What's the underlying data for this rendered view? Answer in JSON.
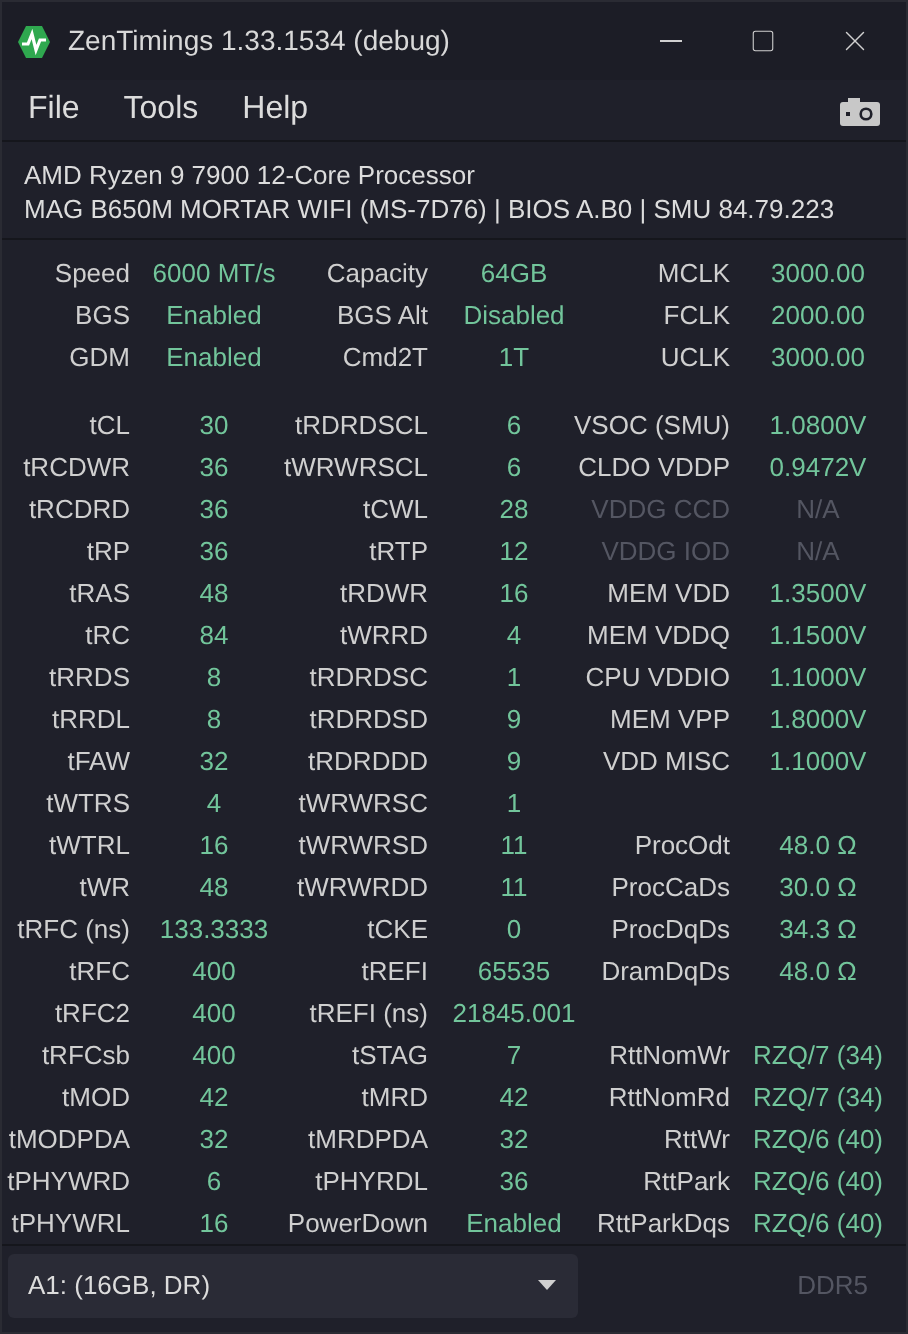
{
  "window": {
    "title": "ZenTimings 1.33.1534 (debug)"
  },
  "menu": [
    "File",
    "Tools",
    "Help"
  ],
  "system_info": {
    "cpu": "AMD Ryzen 9 7900 12-Core Processor",
    "board": "MAG B650M MORTAR WIFI (MS-7D76) | BIOS A.B0 | SMU 84.79.223"
  },
  "summary": [
    {
      "left": {
        "label": "Speed",
        "value": "6000 MT/s",
        "disabled": false
      },
      "middle": {
        "label": "Capacity",
        "value": "64GB",
        "disabled": false
      },
      "right": {
        "label": "MCLK",
        "value": "3000.00",
        "disabled": false
      }
    },
    {
      "left": {
        "label": "BGS",
        "value": "Enabled",
        "disabled": false
      },
      "middle": {
        "label": "BGS Alt",
        "value": "Disabled",
        "disabled": false
      },
      "right": {
        "label": "FCLK",
        "value": "2000.00",
        "disabled": false
      }
    },
    {
      "left": {
        "label": "GDM",
        "value": "Enabled",
        "disabled": false
      },
      "middle": {
        "label": "Cmd2T",
        "value": "1T",
        "disabled": false
      },
      "right": {
        "label": "UCLK",
        "value": "3000.00",
        "disabled": false
      }
    }
  ],
  "timings": [
    {
      "left": {
        "label": "tCL",
        "value": "30",
        "disabled": false
      },
      "middle": {
        "label": "tRDRDSCL",
        "value": "6",
        "disabled": false
      },
      "right": {
        "label": "VSOC (SMU)",
        "value": "1.0800V",
        "disabled": false
      }
    },
    {
      "left": {
        "label": "tRCDWR",
        "value": "36",
        "disabled": false
      },
      "middle": {
        "label": "tWRWRSCL",
        "value": "6",
        "disabled": false
      },
      "right": {
        "label": "CLDO VDDP",
        "value": "0.9472V",
        "disabled": false
      }
    },
    {
      "left": {
        "label": "tRCDRD",
        "value": "36",
        "disabled": false
      },
      "middle": {
        "label": "tCWL",
        "value": "28",
        "disabled": false
      },
      "right": {
        "label": "VDDG CCD",
        "value": "N/A",
        "disabled": true
      }
    },
    {
      "left": {
        "label": "tRP",
        "value": "36",
        "disabled": false
      },
      "middle": {
        "label": "tRTP",
        "value": "12",
        "disabled": false
      },
      "right": {
        "label": "VDDG IOD",
        "value": "N/A",
        "disabled": true
      }
    },
    {
      "left": {
        "label": "tRAS",
        "value": "48",
        "disabled": false
      },
      "middle": {
        "label": "tRDWR",
        "value": "16",
        "disabled": false
      },
      "right": {
        "label": "MEM VDD",
        "value": "1.3500V",
        "disabled": false
      }
    },
    {
      "left": {
        "label": "tRC",
        "value": "84",
        "disabled": false
      },
      "middle": {
        "label": "tWRRD",
        "value": "4",
        "disabled": false
      },
      "right": {
        "label": "MEM VDDQ",
        "value": "1.1500V",
        "disabled": false
      }
    },
    {
      "left": {
        "label": "tRRDS",
        "value": "8",
        "disabled": false
      },
      "middle": {
        "label": "tRDRDSC",
        "value": "1",
        "disabled": false
      },
      "right": {
        "label": "CPU VDDIO",
        "value": "1.1000V",
        "disabled": false
      }
    },
    {
      "left": {
        "label": "tRRDL",
        "value": "8",
        "disabled": false
      },
      "middle": {
        "label": "tRDRDSD",
        "value": "9",
        "disabled": false
      },
      "right": {
        "label": "MEM VPP",
        "value": "1.8000V",
        "disabled": false
      }
    },
    {
      "left": {
        "label": "tFAW",
        "value": "32",
        "disabled": false
      },
      "middle": {
        "label": "tRDRDDD",
        "value": "9",
        "disabled": false
      },
      "right": {
        "label": "VDD MISC",
        "value": "1.1000V",
        "disabled": false
      }
    },
    {
      "left": {
        "label": "tWTRS",
        "value": "4",
        "disabled": false
      },
      "middle": {
        "label": "tWRWRSC",
        "value": "1",
        "disabled": false
      }
    },
    {
      "left": {
        "label": "tWTRL",
        "value": "16",
        "disabled": false
      },
      "middle": {
        "label": "tWRWRSD",
        "value": "11",
        "disabled": false
      },
      "right": {
        "label": "ProcOdt",
        "value": "48.0 Ω",
        "disabled": false
      }
    },
    {
      "left": {
        "label": "tWR",
        "value": "48",
        "disabled": false
      },
      "middle": {
        "label": "tWRWRDD",
        "value": "11",
        "disabled": false
      },
      "right": {
        "label": "ProcCaDs",
        "value": "30.0 Ω",
        "disabled": false
      }
    },
    {
      "left": {
        "label": "tRFC (ns)",
        "value": "133.3333",
        "disabled": false
      },
      "middle": {
        "label": "tCKE",
        "value": "0",
        "disabled": false
      },
      "right": {
        "label": "ProcDqDs",
        "value": "34.3 Ω",
        "disabled": false
      }
    },
    {
      "left": {
        "label": "tRFC",
        "value": "400",
        "disabled": false
      },
      "middle": {
        "label": "tREFI",
        "value": "65535",
        "disabled": false
      },
      "right": {
        "label": "DramDqDs",
        "value": "48.0 Ω",
        "disabled": false
      }
    },
    {
      "left": {
        "label": "tRFC2",
        "value": "400",
        "disabled": false
      },
      "middle": {
        "label": "tREFI (ns)",
        "value": "21845.001",
        "disabled": false
      }
    },
    {
      "left": {
        "label": "tRFCsb",
        "value": "400",
        "disabled": false
      },
      "middle": {
        "label": "tSTAG",
        "value": "7",
        "disabled": false
      },
      "right": {
        "label": "RttNomWr",
        "value": "RZQ/7 (34)",
        "disabled": false
      }
    },
    {
      "left": {
        "label": "tMOD",
        "value": "42",
        "disabled": false
      },
      "middle": {
        "label": "tMRD",
        "value": "42",
        "disabled": false
      },
      "right": {
        "label": "RttNomRd",
        "value": "RZQ/7 (34)",
        "disabled": false
      }
    },
    {
      "left": {
        "label": "tMODPDA",
        "value": "32",
        "disabled": false
      },
      "middle": {
        "label": "tMRDPDA",
        "value": "32",
        "disabled": false
      },
      "right": {
        "label": "RttWr",
        "value": "RZQ/6 (40)",
        "disabled": false
      }
    },
    {
      "left": {
        "label": "tPHYWRD",
        "value": "6",
        "disabled": false
      },
      "middle": {
        "label": "tPHYRDL",
        "value": "36",
        "disabled": false
      },
      "right": {
        "label": "RttPark",
        "value": "RZQ/6 (40)",
        "disabled": false
      }
    },
    {
      "left": {
        "label": "tPHYWRL",
        "value": "16",
        "disabled": false
      },
      "middle": {
        "label": "PowerDown",
        "value": "Enabled",
        "disabled": false
      },
      "right": {
        "label": "RttParkDqs",
        "value": "RZQ/6 (40)",
        "disabled": false
      }
    }
  ],
  "footer": {
    "module_select": "A1:  (16GB, DR)",
    "memory_type": "DDR5"
  }
}
